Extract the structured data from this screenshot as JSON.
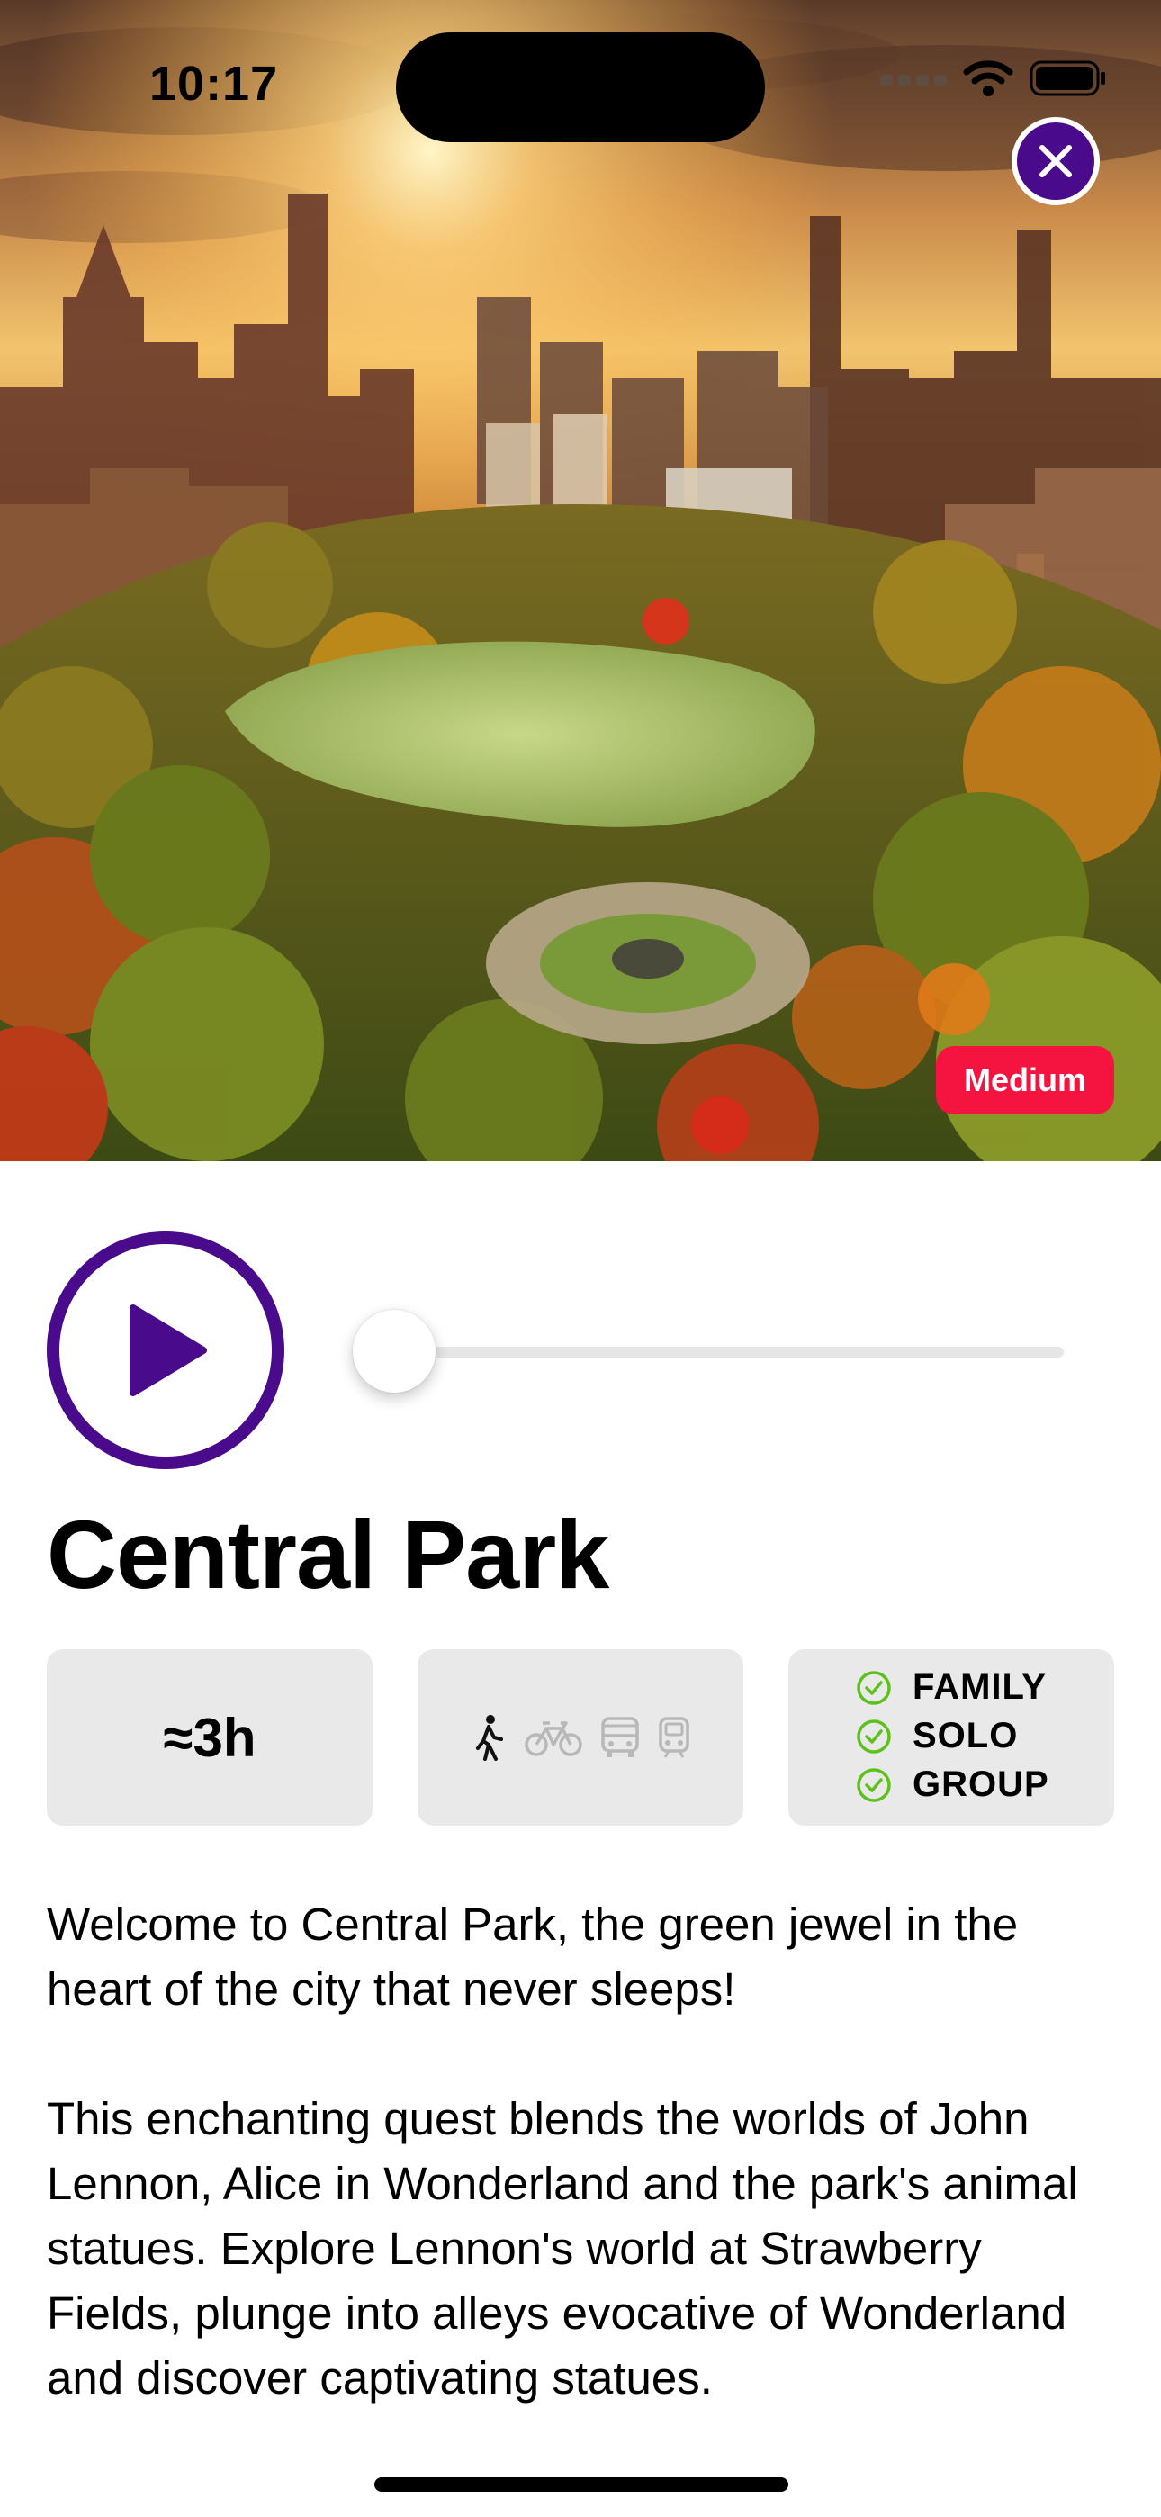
{
  "status_bar": {
    "time": "10:17",
    "icons": [
      "signal-icon",
      "wifi-icon",
      "battery-icon"
    ]
  },
  "hero": {
    "image_subject": "central-park-aerial-photo",
    "close_icon": "close-icon",
    "difficulty": "Medium"
  },
  "player": {
    "play_icon": "play-icon",
    "progress": 0
  },
  "title": "Central Park",
  "info": {
    "duration": "≈3h",
    "transport": [
      {
        "name": "walk-icon",
        "active": true
      },
      {
        "name": "bike-icon",
        "active": false
      },
      {
        "name": "bus-icon",
        "active": false
      },
      {
        "name": "tram-icon",
        "active": false
      }
    ],
    "audience": [
      "FAMILY",
      "SOLO",
      "GROUP"
    ]
  },
  "description": {
    "paragraph1": "Welcome to Central Park, the green jewel in the heart of the city that never sleeps!",
    "paragraph2": "This enchanting quest blends the worlds of John Lennon, Alice in Wonderland and the park's animal statues. Explore Lennon's world at Strawberry Fields, plunge into alleys evocative of Wonderland and discover captivating statues."
  },
  "colors": {
    "accent_purple": "#4a0a8c",
    "badge_red": "#f5133f",
    "card_bg": "#e9e9e9",
    "check_green": "#5cc21a"
  }
}
